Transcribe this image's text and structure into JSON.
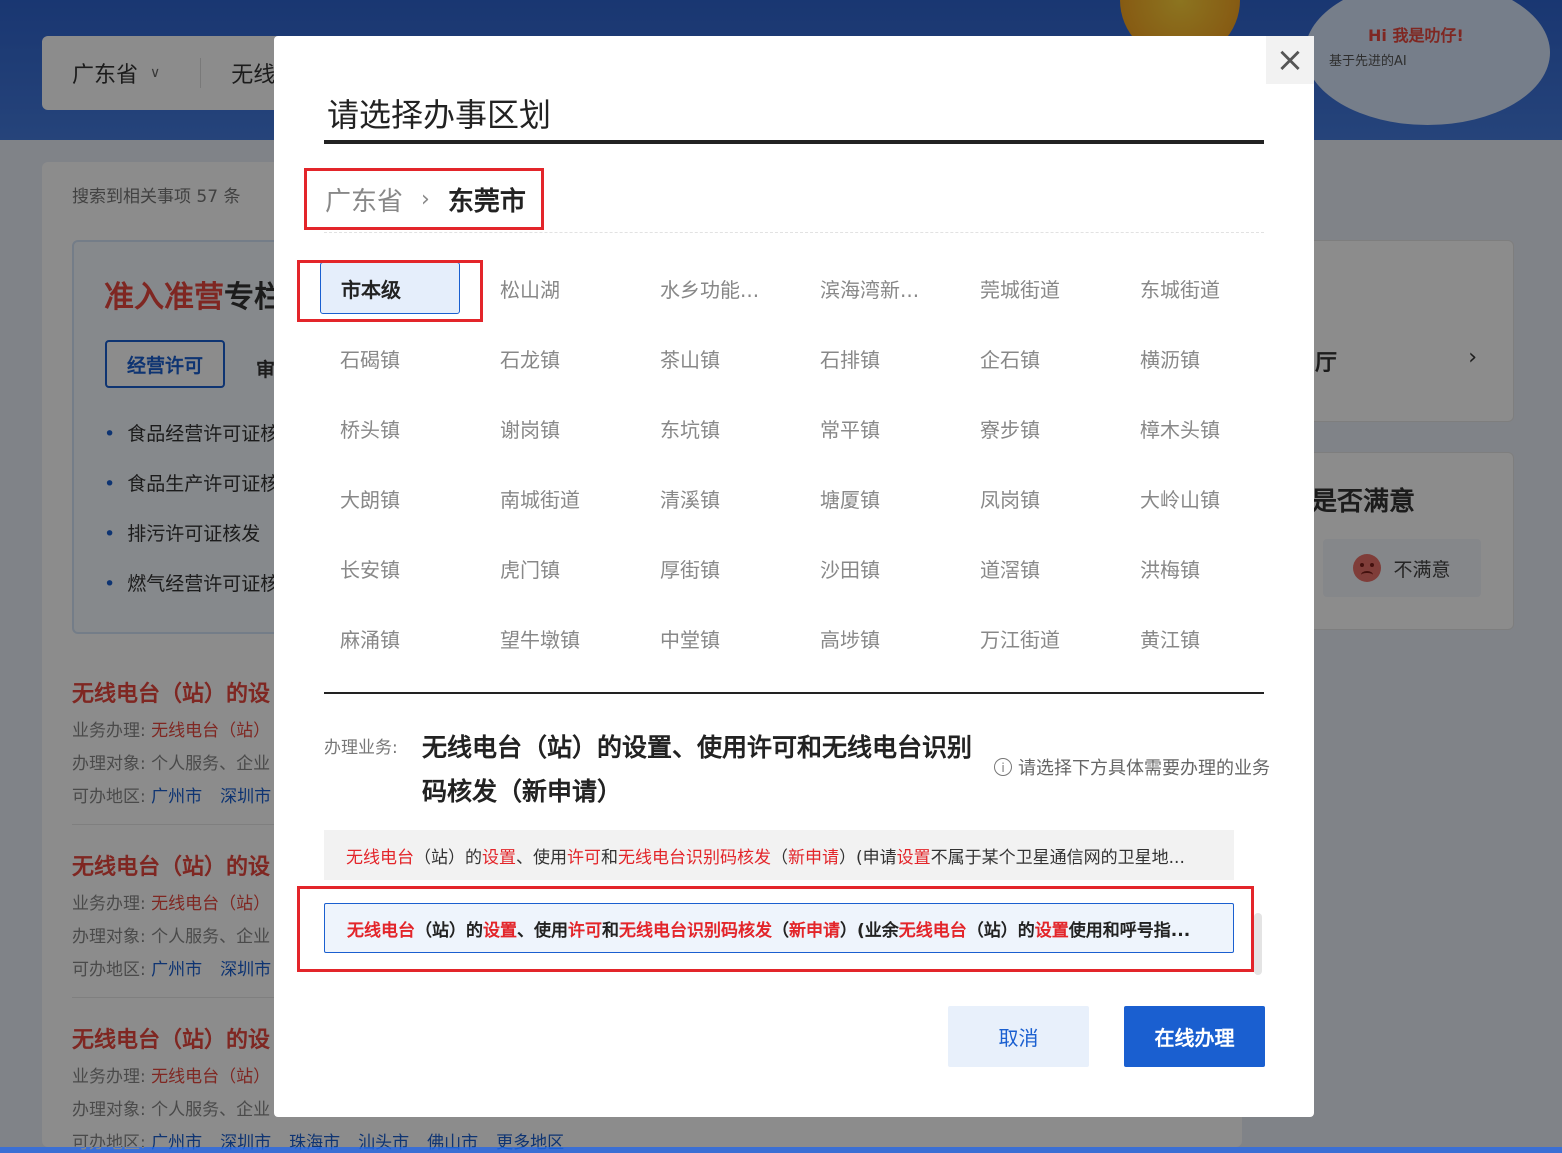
{
  "background": {
    "filter": {
      "province": "广东省",
      "item": "无线"
    },
    "assistant": {
      "greeting": "Hi 我是叻仔!",
      "subtitle": "基于先进的AI"
    },
    "result_count": "搜索到相关事项 57 条",
    "special": {
      "title_red": "准入准营",
      "title_dark": "专栏",
      "tab_active": "经营许可",
      "tab_next": "审"
    },
    "licenses": [
      "食品经营许可证核",
      "食品生产许可证核",
      "排污许可证核发",
      "燃气经营许可证核"
    ],
    "entries": [
      {
        "title": "无线电台（站）的设",
        "label_biz": "业务办理:",
        "biz": "无线电台（站）",
        "label_obj": "办理对象:",
        "obj": "个人服务、企业",
        "label_area": "可办地区:",
        "areas": [
          "广州市",
          "深圳市"
        ]
      },
      {
        "title": "无线电台（站）的设",
        "label_biz": "业务办理:",
        "biz": "无线电台（站）",
        "label_obj": "办理对象:",
        "obj": "个人服务、企业",
        "label_area": "可办地区:",
        "areas": [
          "广州市",
          "深圳市"
        ]
      },
      {
        "title": "无线电台（站）的设",
        "label_biz": "业务办理:",
        "biz": "无线电台（站）",
        "label_obj": "办理对象:",
        "obj": "个人服务、企业",
        "label_area": "可办地区:",
        "areas": [
          "广州市",
          "深圳市",
          "珠海市",
          "汕头市",
          "佛山市",
          "更多地区"
        ]
      }
    ],
    "right_card": {
      "text": "厅",
      "arrow": "›"
    },
    "satisfaction": {
      "title": "是否满意",
      "unsatisfied": "不满意"
    }
  },
  "modal": {
    "title": "请选择办事区划",
    "close": "×",
    "breadcrumb": {
      "province": "广东省",
      "separator": "›",
      "city": "东莞市"
    },
    "districts": [
      "市本级",
      "松山湖",
      "水乡功能...",
      "滨海湾新...",
      "莞城街道",
      "东城街道",
      "石碣镇",
      "石龙镇",
      "茶山镇",
      "石排镇",
      "企石镇",
      "横沥镇",
      "桥头镇",
      "谢岗镇",
      "东坑镇",
      "常平镇",
      "寮步镇",
      "樟木头镇",
      "大朗镇",
      "南城街道",
      "清溪镇",
      "塘厦镇",
      "凤岗镇",
      "大岭山镇",
      "长安镇",
      "虎门镇",
      "厚街镇",
      "沙田镇",
      "道滘镇",
      "洪梅镇",
      "麻涌镇",
      "望牛墩镇",
      "中堂镇",
      "高埗镇",
      "万江街道",
      "黄江镇"
    ],
    "selected_district": 0,
    "business_label": "办理业务:",
    "business_name": "无线电台（站）的设置、使用许可和无线电台识别码核发（新申请）",
    "hint": "请选择下方具体需要办理的业务",
    "options": [
      [
        {
          "t": "无线电台",
          "r": true
        },
        {
          "t": "（站）的",
          "r": false
        },
        {
          "t": "设置",
          "r": true
        },
        {
          "t": "、使用",
          "r": false
        },
        {
          "t": "许可",
          "r": true
        },
        {
          "t": "和",
          "r": false
        },
        {
          "t": "无线电台识别码核发",
          "r": true
        },
        {
          "t": "（",
          "r": false
        },
        {
          "t": "新申请",
          "r": true
        },
        {
          "t": "）(申请",
          "r": false
        },
        {
          "t": "设置",
          "r": true
        },
        {
          "t": "不属于某个卫星通信网的卫星地...",
          "r": false
        }
      ],
      [
        {
          "t": "无线电台",
          "r": true
        },
        {
          "t": "（站）的",
          "r": false
        },
        {
          "t": "设置",
          "r": true
        },
        {
          "t": "、使用",
          "r": false
        },
        {
          "t": "许可",
          "r": true
        },
        {
          "t": "和",
          "r": false
        },
        {
          "t": "无线电台识别码核发",
          "r": true
        },
        {
          "t": "（",
          "r": false
        },
        {
          "t": "新申请",
          "r": true
        },
        {
          "t": "）(业余",
          "r": false
        },
        {
          "t": "无线电台",
          "r": true
        },
        {
          "t": "（站）的",
          "r": false
        },
        {
          "t": "设置",
          "r": true
        },
        {
          "t": "使用和呼号指...",
          "r": false
        }
      ]
    ],
    "selected_option": 1,
    "buttons": {
      "cancel": "取消",
      "online": "在线办理"
    }
  }
}
